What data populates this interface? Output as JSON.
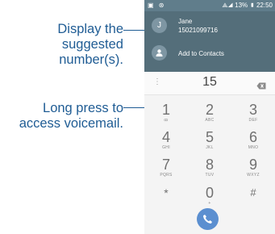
{
  "callouts": {
    "suggested": "Display the\nsuggested\nnumber(s).",
    "voicemail": "Long press to\naccess voicemail."
  },
  "status_bar": {
    "left": "▣ ⊛",
    "right": "⟁◢ 13% ▮ 22:50"
  },
  "suggestion": {
    "avatar_letter": "J",
    "name": "Jane",
    "number": "15021099716",
    "add_contact_label": "Add to Contacts"
  },
  "dialer": {
    "menu": "⋮",
    "typed_number": "15",
    "keys": [
      {
        "digit": "1",
        "letters": "ꝏ"
      },
      {
        "digit": "2",
        "letters": "ABC"
      },
      {
        "digit": "3",
        "letters": "DEF"
      },
      {
        "digit": "4",
        "letters": "GHI"
      },
      {
        "digit": "5",
        "letters": "JKL"
      },
      {
        "digit": "6",
        "letters": "MNO"
      },
      {
        "digit": "7",
        "letters": "PQRS"
      },
      {
        "digit": "8",
        "letters": "TUV"
      },
      {
        "digit": "9",
        "letters": "WXYZ"
      },
      {
        "digit": "*",
        "letters": ""
      },
      {
        "digit": "0",
        "letters": "+"
      },
      {
        "digit": "#",
        "letters": ""
      }
    ]
  },
  "colors": {
    "callout_text": "#1f5c94",
    "header": "#546e7a",
    "call_button": "#5b8fd0"
  },
  "icons": {
    "backspace": "backspace-icon",
    "add_contact": "add-person-icon",
    "call": "phone-icon"
  }
}
